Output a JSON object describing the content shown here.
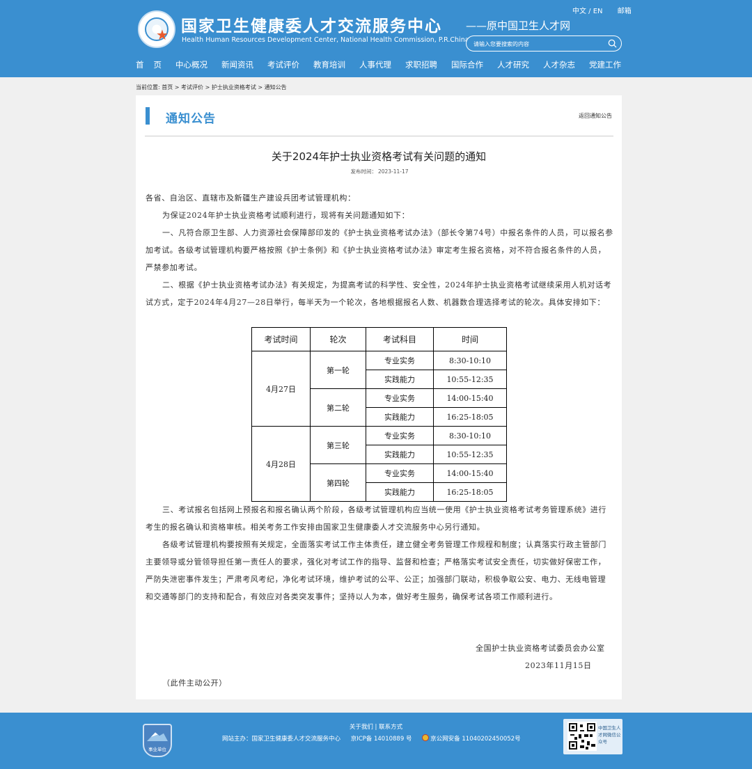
{
  "colors": {
    "brand_blue": "#3a8fd0",
    "panel_bg": "#ffffff",
    "page_bg": "#f0f0f0"
  },
  "header": {
    "title": "国家卫生健康委人才交流服务中心",
    "title_en": "Health Human Resources Development Center, National Health Commission, P.R.China",
    "slogan": "——原中国卫生人才网",
    "lang": "中文 / EN",
    "mail": "邮箱",
    "search_placeholder": "请输入您要搜索的内容",
    "nav": [
      "首页",
      "中心概况",
      "新闻资讯",
      "考试评价",
      "教育培训",
      "人事代理",
      "求职招聘",
      "国际合作",
      "人才研究",
      "人才杂志",
      "党建工作"
    ]
  },
  "breadcrumb": {
    "label": "当前位置:",
    "items": [
      "首页",
      "考试评价",
      "护士执业资格考试",
      "通知公告"
    ],
    "sep": " > "
  },
  "section": {
    "title": "通知公告",
    "back_link": "返回通知公告"
  },
  "article": {
    "title": "关于2024年护士执业资格考试有关问题的通知",
    "date_label": "发布时间：",
    "date": "2023-11-17",
    "salutation": "各省、自治区、直辖市及新疆生产建设兵团考试管理机构：",
    "p_intro": "为保证2024年护士执业资格考试顺利进行，现将有关问题通知如下：",
    "p1": "一、凡符合原卫生部、人力资源社会保障部印发的《护士执业资格考试办法》（部长令第74号）中报名条件的人员，可以报名参加考试。各级考试管理机构要严格按照《护士条例》和《护士执业资格考试办法》审定考生报名资格，对不符合报名条件的人员，严禁参加考试。",
    "p2": "二、根据《护士执业资格考试办法》有关规定，为提高考试的科学性、安全性，2024年护士执业资格考试继续采用人机对话考试方式，定于2024年4月27—28日举行，每半天为一个轮次，各地根据报名人数、机器数合理选择考试的轮次。具体安排如下：",
    "p3": "三、考试报名包括网上预报名和报名确认两个阶段，各级考试管理机构应当统一使用《护士执业资格考试考务管理系统》进行考生的报名确认和资格审核。相关考务工作安排由国家卫生健康委人才交流服务中心另行通知。",
    "p4": "各级考试管理机构要按照有关规定，全面落实考试工作主体责任，建立健全考务管理工作规程和制度；认真落实行政主管部门主要领导或分管领导担任第一责任人的要求，强化对考试工作的指导、监督和检查；严格落实考试安全责任，切实做好保密工作，严防失泄密事件发生；严肃考风考纪，净化考试环境，维护考试的公平、公正；加强部门联动，积极争取公安、电力、无线电管理和交通等部门的支持和配合，有效应对各类突发事件；坚持以人为本，做好考生服务，确保考试各项工作顺利进行。",
    "signer": "全国护士执业资格考试委员会办公室",
    "sign_date": "2023年11月15日",
    "note": "（此件主动公开）"
  },
  "schedule": {
    "headers": [
      "考试时间",
      "轮次",
      "考试科目",
      "时间"
    ],
    "days": [
      {
        "date": "4月27日",
        "rounds": [
          {
            "name": "第一轮",
            "slots": [
              {
                "subject": "专业实务",
                "time": "8:30-10:10"
              },
              {
                "subject": "实践能力",
                "time": "10:55-12:35"
              }
            ]
          },
          {
            "name": "第二轮",
            "slots": [
              {
                "subject": "专业实务",
                "time": "14:00-15:40"
              },
              {
                "subject": "实践能力",
                "time": "16:25-18:05"
              }
            ]
          }
        ]
      },
      {
        "date": "4月28日",
        "rounds": [
          {
            "name": "第三轮",
            "slots": [
              {
                "subject": "专业实务",
                "time": "8:30-10:10"
              },
              {
                "subject": "实践能力",
                "time": "10:55-12:35"
              }
            ]
          },
          {
            "name": "第四轮",
            "slots": [
              {
                "subject": "专业实务",
                "time": "14:00-15:40"
              },
              {
                "subject": "实践能力",
                "time": "16:25-18:05"
              }
            ]
          }
        ]
      }
    ]
  },
  "footer": {
    "links": "关于我们 | 联系方式",
    "host": "网站主办：国家卫生健康委人才交流服务中心",
    "icp": "京ICP备 14010889 号",
    "police": "京公网安备 11040202450052号",
    "emblem_text": "事业单位",
    "qr_text": "中国卫生人才网微信公众号"
  }
}
